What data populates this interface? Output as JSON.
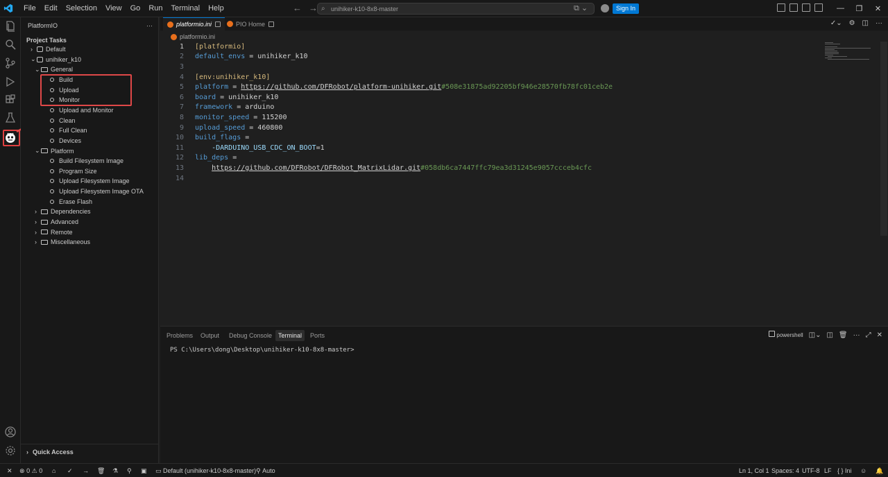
{
  "titlebar": {
    "menus": [
      "File",
      "Edit",
      "Selection",
      "View",
      "Go",
      "Run",
      "Terminal",
      "Help"
    ],
    "command_center": "unihiker-k10-8x8-master",
    "sign_in": "Sign In"
  },
  "sidebar": {
    "title": "PlatformIO",
    "section": "Project Tasks",
    "tree": [
      {
        "label": "Default",
        "level": 0,
        "kind": "project",
        "expanded": false
      },
      {
        "label": "unihiker_k10",
        "level": 0,
        "kind": "project",
        "expanded": true
      },
      {
        "label": "General",
        "level": 1,
        "kind": "folder",
        "expanded": true
      },
      {
        "label": "Build",
        "level": 2,
        "kind": "task"
      },
      {
        "label": "Upload",
        "level": 2,
        "kind": "task"
      },
      {
        "label": "Monitor",
        "level": 2,
        "kind": "task"
      },
      {
        "label": "Upload and Monitor",
        "level": 2,
        "kind": "task"
      },
      {
        "label": "Clean",
        "level": 2,
        "kind": "task"
      },
      {
        "label": "Full Clean",
        "level": 2,
        "kind": "task"
      },
      {
        "label": "Devices",
        "level": 2,
        "kind": "task"
      },
      {
        "label": "Platform",
        "level": 1,
        "kind": "folder",
        "expanded": true
      },
      {
        "label": "Build Filesystem Image",
        "level": 2,
        "kind": "task"
      },
      {
        "label": "Program Size",
        "level": 2,
        "kind": "task"
      },
      {
        "label": "Upload Filesystem Image",
        "level": 2,
        "kind": "task"
      },
      {
        "label": "Upload Filesystem Image OTA",
        "level": 2,
        "kind": "task"
      },
      {
        "label": "Erase Flash",
        "level": 2,
        "kind": "task"
      },
      {
        "label": "Dependencies",
        "level": 1,
        "kind": "folder",
        "expanded": false
      },
      {
        "label": "Advanced",
        "level": 1,
        "kind": "folder",
        "expanded": false
      },
      {
        "label": "Remote",
        "level": 1,
        "kind": "folder",
        "expanded": false
      },
      {
        "label": "Miscellaneous",
        "level": 1,
        "kind": "folder",
        "expanded": false
      }
    ],
    "quick_access": "Quick Access"
  },
  "tabs": [
    {
      "label": "platformio.ini",
      "active": true
    },
    {
      "label": "PIO Home",
      "active": false
    }
  ],
  "breadcrumb": "platformio.ini",
  "editor": {
    "lines": [
      {
        "n": "1",
        "parts": [
          [
            "sec",
            "[platformio]"
          ]
        ]
      },
      {
        "n": "2",
        "parts": [
          [
            "key",
            "default_envs"
          ],
          [
            "val",
            " = unihiker_k10"
          ]
        ]
      },
      {
        "n": "3",
        "parts": []
      },
      {
        "n": "4",
        "parts": [
          [
            "sec",
            "[env:unihiker_k10]"
          ]
        ]
      },
      {
        "n": "5",
        "parts": [
          [
            "key",
            "platform"
          ],
          [
            "val",
            " = "
          ],
          [
            "link",
            "https://github.com/DFRobot/platform-unihiker.git"
          ],
          [
            "hash",
            "#508e31875ad92205bf946e28570fb78fc01ceb2e"
          ]
        ]
      },
      {
        "n": "6",
        "parts": [
          [
            "key",
            "board"
          ],
          [
            "val",
            " = unihiker_k10"
          ]
        ]
      },
      {
        "n": "7",
        "parts": [
          [
            "key",
            "framework"
          ],
          [
            "val",
            " = arduino"
          ]
        ]
      },
      {
        "n": "8",
        "parts": [
          [
            "key",
            "monitor_speed"
          ],
          [
            "val",
            " = 115200"
          ]
        ]
      },
      {
        "n": "9",
        "parts": [
          [
            "key",
            "upload_speed"
          ],
          [
            "val",
            " = 460800"
          ]
        ]
      },
      {
        "n": "10",
        "parts": [
          [
            "key",
            "build_flags"
          ],
          [
            "val",
            " ="
          ]
        ]
      },
      {
        "n": "11",
        "parts": [
          [
            "val",
            "    "
          ],
          [
            "flag",
            "-DARDUINO_USB_CDC_ON_BOOT"
          ],
          [
            "val",
            "=1"
          ]
        ]
      },
      {
        "n": "12",
        "parts": [
          [
            "key",
            "lib_deps"
          ],
          [
            "val",
            " ="
          ]
        ]
      },
      {
        "n": "13",
        "parts": [
          [
            "val",
            "    "
          ],
          [
            "link",
            "https://github.com/DFRobot/DFRobot_MatrixLidar.git"
          ],
          [
            "hash",
            "#058db6ca7447ffc79ea3d31245e9057ccceb4cfc"
          ]
        ]
      },
      {
        "n": "14",
        "parts": []
      }
    ]
  },
  "panel": {
    "tabs": [
      "Problems",
      "Output",
      "Debug Console",
      "Terminal",
      "Ports"
    ],
    "active_tab": "Terminal",
    "shell": "powershell",
    "prompt": "PS C:\\Users\\dong\\Desktop\\unihiker-k10-8x8-master>"
  },
  "statusbar": {
    "errors": "0",
    "warnings": "0",
    "env": "Default (unihiker-k10-8x8-master)",
    "auto": "Auto",
    "position": "Ln 1, Col 1",
    "spaces": "Spaces: 4",
    "encoding": "UTF-8",
    "eol": "LF",
    "language": "Ini"
  },
  "colors": {
    "accent": "#0078d4",
    "highlight": "#e04848",
    "pio_orange": "#e86f1c"
  }
}
